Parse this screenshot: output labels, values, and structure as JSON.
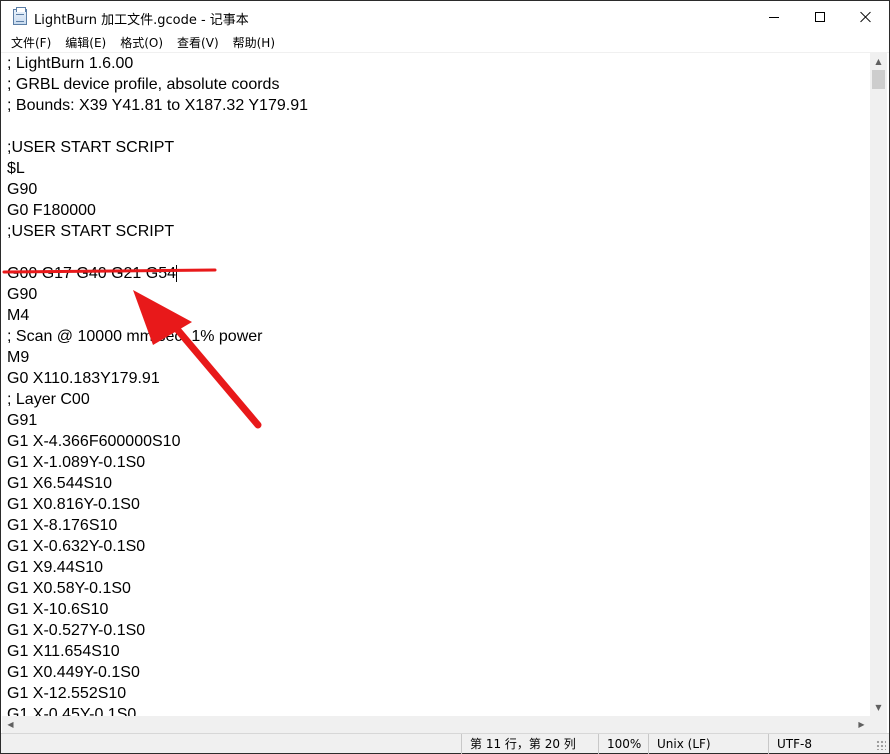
{
  "window": {
    "title": "LightBurn 加工文件.gcode - 记事本",
    "icon": "notepad-icon"
  },
  "menu": [
    {
      "label": "文件(F)"
    },
    {
      "label": "编辑(E)"
    },
    {
      "label": "格式(O)"
    },
    {
      "label": "查看(V)"
    },
    {
      "label": "帮助(H)"
    }
  ],
  "editor": {
    "lines": [
      "; LightBurn 1.6.00",
      "; GRBL device profile, absolute coords",
      "; Bounds: X39 Y41.81 to X187.32 Y179.91",
      "",
      ";USER START SCRIPT",
      "$L",
      "G90",
      "G0 F180000",
      ";USER START SCRIPT",
      "",
      "G00 G17 G40 G21 G54",
      "G90",
      "M4",
      "; Scan @ 10000 mm/sec, 1% power",
      "M9",
      "G0 X110.183Y179.91",
      "; Layer C00",
      "G91",
      "G1 X-4.366F600000S10",
      "G1 X-1.089Y-0.1S0",
      "G1 X6.544S10",
      "G1 X0.816Y-0.1S0",
      "G1 X-8.176S10",
      "G1 X-0.632Y-0.1S0",
      "G1 X9.44S10",
      "G1 X0.58Y-0.1S0",
      "G1 X-10.6S10",
      "G1 X-0.527Y-0.1S0",
      "G1 X11.654S10",
      "G1 X0.449Y-0.1S0",
      "G1 X-12.552S10",
      "G1 X-0.45Y-0.1S0"
    ],
    "struck_line_index": 10,
    "caret_line_index": 10
  },
  "statusbar": {
    "position": "第 11 行，第 20 列",
    "zoom": "100%",
    "line_ending": "Unix (LF)",
    "encoding": "UTF-8"
  },
  "annotation": {
    "color": "#e8191a",
    "strike_icon": "red-strikethrough-line",
    "arrow_icon": "red-pointer-arrow"
  }
}
